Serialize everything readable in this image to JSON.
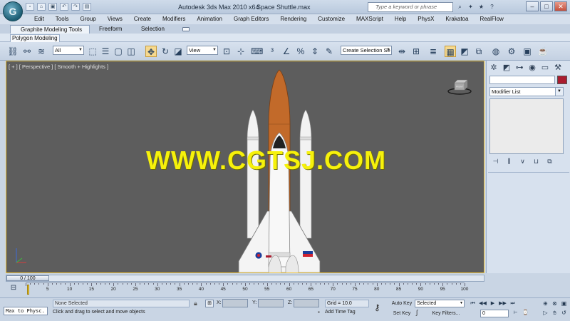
{
  "titlebar": {
    "app_title": "Autodesk 3ds Max  2010 x64",
    "file_name": "Space Shuttle.max",
    "search_placeholder": "Type a keyword or phrase"
  },
  "menu": [
    "Edit",
    "Tools",
    "Group",
    "Views",
    "Create",
    "Modifiers",
    "Animation",
    "Graph Editors",
    "Rendering",
    "Customize",
    "MAXScript",
    "Help",
    "PhysX",
    "Krakatoa",
    "RealFlow"
  ],
  "ribbon": {
    "tabs": [
      "Graphite Modeling Tools",
      "Freeform",
      "Selection"
    ],
    "panel_label": "Polygon Modeling"
  },
  "toolbar": {
    "filter_value": "All",
    "ref_coord_value": "View",
    "named_selection_value": "Create Selection Se"
  },
  "viewport": {
    "label": "[ + ] [ Perspective ] [ Smooth + Highlights ]",
    "watermark": "WWW.CGTSJ.COM",
    "viewcube_text": "FRONT"
  },
  "command_panel": {
    "modifier_list": "Modifier List"
  },
  "timeline": {
    "slider_text": "0 / 100",
    "ticks": [
      "5",
      "10",
      "15",
      "20",
      "25",
      "30",
      "35",
      "40",
      "45",
      "50",
      "55",
      "60",
      "65",
      "70",
      "75",
      "80",
      "85",
      "90",
      "95",
      "100"
    ]
  },
  "status": {
    "listener": "Max to Physc.",
    "selection": "None Selected",
    "prompt": "Click and drag to select and move objects",
    "x_label": "X:",
    "y_label": "Y:",
    "z_label": "Z:",
    "grid": "Grid = 10.0",
    "add_time_tag": "Add Time Tag",
    "auto_key": "Auto Key",
    "set_key": "Set Key",
    "selected_value": "Selected",
    "key_filters": "Key Filters...",
    "frame_value": "0"
  },
  "colors": {
    "viewport_bg": "#5d5d5d",
    "active_border": "#f2c63c",
    "watermark": "#f6f10b",
    "external_tank": "#c26a2a",
    "object_color": "#aa1c2f"
  }
}
